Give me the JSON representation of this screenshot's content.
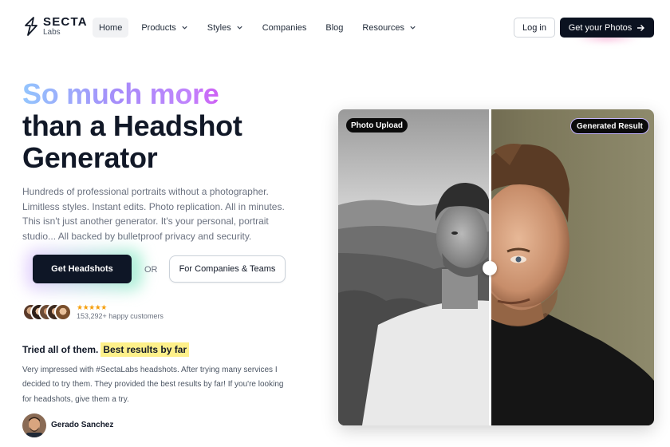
{
  "brand": {
    "name_top": "SECTA",
    "name_bottom": "Labs"
  },
  "nav": {
    "items": [
      {
        "label": "Home",
        "active": true,
        "dropdown": false
      },
      {
        "label": "Products",
        "active": false,
        "dropdown": true
      },
      {
        "label": "Styles",
        "active": false,
        "dropdown": true
      },
      {
        "label": "Companies",
        "active": false,
        "dropdown": false
      },
      {
        "label": "Blog",
        "active": false,
        "dropdown": false
      },
      {
        "label": "Resources",
        "active": false,
        "dropdown": true
      }
    ],
    "login_label": "Log in",
    "cta_label": "Get your Photos"
  },
  "hero": {
    "headline_gradient": "So much more",
    "headline_line2": "than a Headshot",
    "headline_line3": "Generator",
    "subtext": "Hundreds of professional portraits without a photographer. Limitless styles. Instant edits. Photo replication. All in minutes. This isn't just another generator. It's your personal, portrait studio... All backed by bulletproof privacy and security.",
    "primary_button": "Get Headshots",
    "or_text": "OR",
    "secondary_button": "For Companies & Teams"
  },
  "social_proof": {
    "stars": "★★★★★",
    "customers_text": "153,292+ happy customers"
  },
  "testimonial": {
    "title": "Tried all of them.",
    "highlight": "Best results by far",
    "quote": "Very impressed with #SectaLabs headshots. After trying many services I decided to try them. They provided the best results by far! If you're looking for headshots, give them a try.",
    "author": "Gerado Sanchez"
  },
  "comparison": {
    "left_label": "Photo Upload",
    "right_label": "Generated Result"
  },
  "colors": {
    "primary_dark": "#0e1626",
    "gradient_start": "#93c5fd",
    "gradient_end": "#d946ef",
    "highlight": "#fef08a",
    "star": "#f59e0b"
  },
  "icons": [
    "secta-logo-icon",
    "chevron-down-icon",
    "arrow-right-icon"
  ]
}
